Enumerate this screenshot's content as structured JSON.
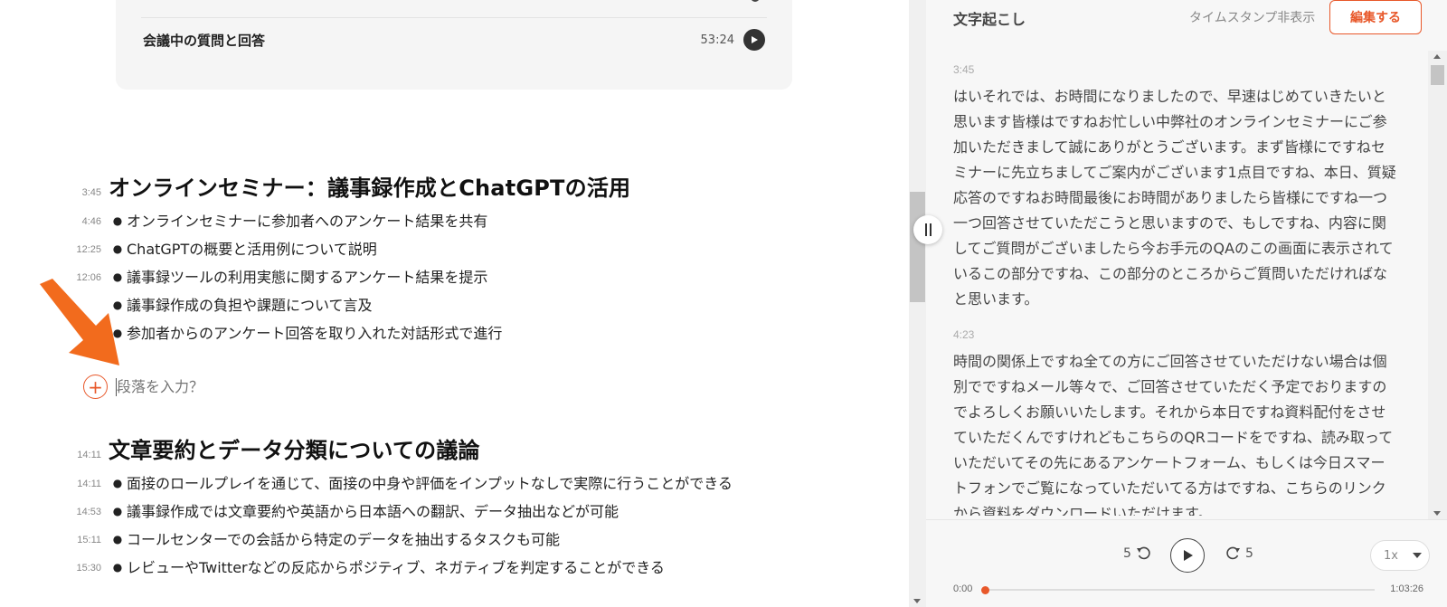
{
  "colors": {
    "accent": "#e8582a"
  },
  "summary_card": {
    "row_title": "会議中の質問と回答",
    "row_time": "53:24"
  },
  "sections": [
    {
      "time": "3:45",
      "heading": "オンラインセミナー：議事録作成とChatGPTの活用",
      "bullets": [
        {
          "time": "4:46",
          "text": "オンラインセミナーに参加者へのアンケート結果を共有"
        },
        {
          "time": "12:25",
          "text": "ChatGPTの概要と活用例について説明"
        },
        {
          "time": "12:06",
          "text": "議事録ツールの利用実態に関するアンケート結果を提示"
        },
        {
          "time": "",
          "text": "議事録作成の負担や課題について言及"
        },
        {
          "time": "",
          "text": "参加者からのアンケート回答を取り入れた対話形式で進行"
        }
      ]
    },
    {
      "time": "14:11",
      "heading": "文章要約とデータ分類についての議論",
      "bullets": [
        {
          "time": "14:11",
          "text": "面接のロールプレイを通じて、面接の中身や評価をインプットなしで実際に行うことができる"
        },
        {
          "time": "14:53",
          "text": "議事録作成では文章要約や英語から日本語への翻訳、データ抽出などが可能"
        },
        {
          "time": "15:11",
          "text": "コールセンターでの会話から特定のデータを抽出するタスクも可能"
        },
        {
          "time": "15:30",
          "text": "レビューやTwitterなどの反応からポジティブ、ネガティブを判定することができる"
        }
      ]
    }
  ],
  "paragraph_input": {
    "placeholder": "段落を入力？"
  },
  "transcript_panel": {
    "title": "文字起こし",
    "timestamp_toggle": "タイムスタンプ非表示",
    "edit_button": "編集する",
    "blocks": [
      {
        "time": "3:45",
        "text": "はいそれでは、お時間になりましたので、早速はじめていきたいと思います皆様はですねお忙しい中弊社のオンラインセミナーにご参加いただきまして誠にありがとうございます。まず皆様にですねセミナーに先立ちましてご案内がございます1点目ですね、本日、質疑応答のですねお時間最後にお時間がありましたら皆様にですね一つ一つ回答させていただこうと思いますので、もしですね、内容に関してご質問がございましたら今お手元のQAのこの画面に表示されているこの部分ですね、この部分のところからご質問いただければなと思います。"
      },
      {
        "time": "4:23",
        "text": "時間の関係上ですね全ての方にご回答させていただけない場合は個別でですねメール等々で、ご回答させていただく予定でおりますのでよろしくお願いいたします。それから本日ですね資料配付をさせていただくんですけれどもこちらのQRコードをですね、読み取っていただいてその先にあるアンケートフォーム、もしくは今日スマートフォンでご覧になっていただいてる方はですね、こちらのリンクから資料をダウンロードいただけます。"
      }
    ]
  },
  "player": {
    "skip_back": "5",
    "skip_forward": "5",
    "speed": "1x",
    "current_time": "0:00",
    "total_time": "1:03:26",
    "progress": 0
  }
}
